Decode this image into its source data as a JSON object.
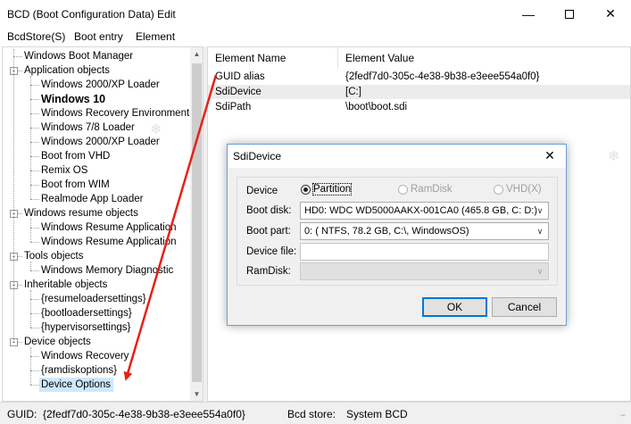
{
  "window": {
    "title": "BCD (Boot Configuration Data) Edit",
    "minimize_icon": "minimize-icon",
    "maximize_icon": "maximize-icon",
    "close_icon": "close-icon"
  },
  "menu": [
    "BcdStore(S)",
    "Boot entry",
    "Element"
  ],
  "tree": {
    "items": [
      {
        "label": "Windows Boot Manager",
        "level": 0,
        "expander": ""
      },
      {
        "label": "Application objects",
        "level": 0,
        "expander": "-"
      },
      {
        "label": "Windows 2000/XP Loader",
        "level": 1,
        "expander": ""
      },
      {
        "label": "Windows 10",
        "level": 1,
        "expander": "",
        "bold": true
      },
      {
        "label": "Windows Recovery Environment",
        "level": 1,
        "expander": ""
      },
      {
        "label": "Windows 7/8 Loader",
        "level": 1,
        "expander": ""
      },
      {
        "label": "Windows 2000/XP Loader",
        "level": 1,
        "expander": ""
      },
      {
        "label": "Boot from VHD",
        "level": 1,
        "expander": ""
      },
      {
        "label": "Remix OS",
        "level": 1,
        "expander": ""
      },
      {
        "label": "Boot from WIM",
        "level": 1,
        "expander": ""
      },
      {
        "label": "Realmode App Loader",
        "level": 1,
        "expander": ""
      },
      {
        "label": "Windows resume objects",
        "level": 0,
        "expander": "-"
      },
      {
        "label": "Windows Resume Application",
        "level": 1,
        "expander": ""
      },
      {
        "label": "Windows Resume Application",
        "level": 1,
        "expander": ""
      },
      {
        "label": "Tools objects",
        "level": 0,
        "expander": "-"
      },
      {
        "label": "Windows Memory Diagnostic",
        "level": 1,
        "expander": ""
      },
      {
        "label": "Inheritable objects",
        "level": 0,
        "expander": "-"
      },
      {
        "label": "{resumeloadersettings}",
        "level": 1,
        "expander": ""
      },
      {
        "label": "{bootloadersettings}",
        "level": 1,
        "expander": ""
      },
      {
        "label": "{hypervisorsettings}",
        "level": 1,
        "expander": ""
      },
      {
        "label": "Device objects",
        "level": 0,
        "expander": "-"
      },
      {
        "label": "Windows Recovery",
        "level": 1,
        "expander": ""
      },
      {
        "label": "{ramdiskoptions}",
        "level": 1,
        "expander": ""
      },
      {
        "label": "Device Options",
        "level": 1,
        "expander": "",
        "selected": true
      }
    ]
  },
  "list": {
    "columns": [
      "Element Name",
      "Element Value"
    ],
    "rows": [
      {
        "name": "GUID alias",
        "value": "{2fedf7d0-305c-4e38-9b38-e3eee554a0f0}"
      },
      {
        "name": "SdiDevice",
        "value": "[C:]"
      },
      {
        "name": "SdiPath",
        "value": "\\boot\\boot.sdi"
      }
    ]
  },
  "status": {
    "guid_label": "GUID:",
    "guid_value": "{2fedf7d0-305c-4e38-9b38-e3eee554a0f0}",
    "store_label": "Bcd store:",
    "store_value": "System BCD"
  },
  "dialog": {
    "title": "SdiDevice",
    "device_label": "Device",
    "device_options": [
      {
        "label": "Partition",
        "checked": true,
        "enabled": true
      },
      {
        "label": "RamDisk",
        "checked": false,
        "enabled": false
      },
      {
        "label": "VHD(X)",
        "checked": false,
        "enabled": false
      }
    ],
    "boot_disk_label": "Boot disk:",
    "boot_disk_value": "HD0: WDC WD5000AAKX-001CA0 (465.8 GB, C: D:)",
    "boot_part_label": "Boot part:",
    "boot_part_value": "0: ( NTFS,  78.2 GB, C:\\, WindowsOS)",
    "device_file_label": "Device file:",
    "device_file_value": "",
    "ramdisk_label": "RamDisk:",
    "ramdisk_value": "",
    "ok_label": "OK",
    "cancel_label": "Cancel"
  },
  "colors": {
    "selection": "#cde8ff",
    "annotation_arrow": "#e8201a",
    "dialog_border": "#6f9ed6",
    "default_button_border": "#0078d7"
  }
}
